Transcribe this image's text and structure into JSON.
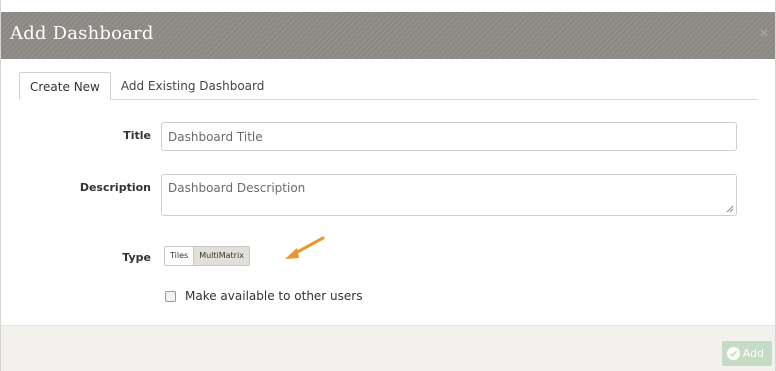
{
  "dialog": {
    "title": "Add Dashboard",
    "close_symbol": "×"
  },
  "tabs": [
    {
      "label": "Create New",
      "active": true
    },
    {
      "label": "Add Existing Dashboard",
      "active": false
    }
  ],
  "form": {
    "title": {
      "label": "Title",
      "value": "",
      "placeholder": "Dashboard Title"
    },
    "description": {
      "label": "Description",
      "value": "",
      "placeholder": "Dashboard Description"
    },
    "type": {
      "label": "Type",
      "options": [
        "Tiles",
        "MultiMatrix"
      ],
      "selected": "MultiMatrix"
    },
    "share": {
      "label": "Make available to other users",
      "checked": false
    }
  },
  "footer": {
    "add_label": "Add",
    "add_icon": "check-circle-icon"
  },
  "colors": {
    "titlebar": "#8f8b87",
    "footer": "#f3f1ed",
    "add_button": "#c4dcc4",
    "arrow": "#e8962e"
  }
}
